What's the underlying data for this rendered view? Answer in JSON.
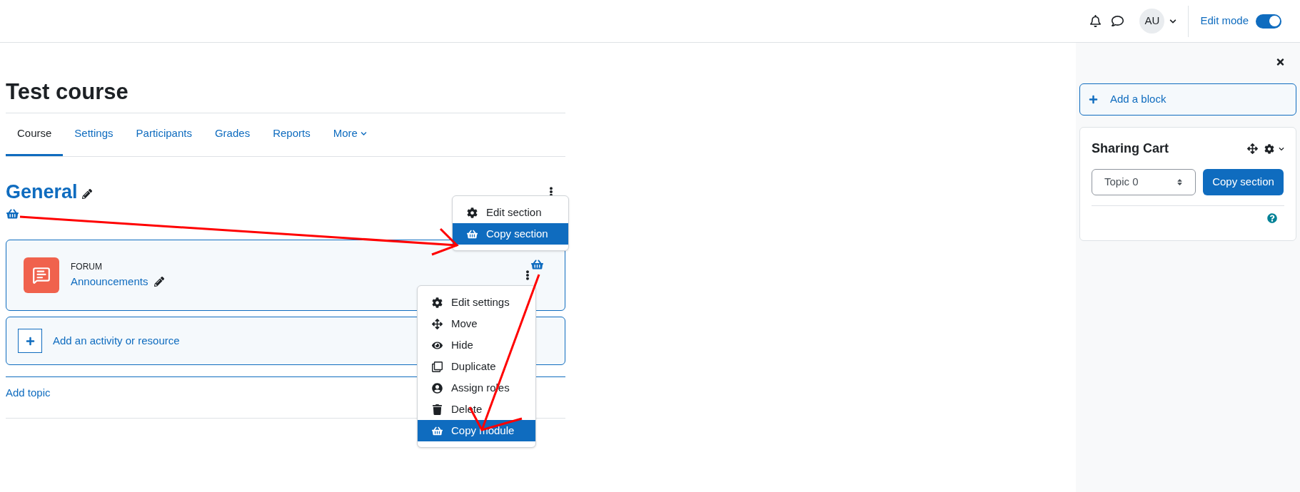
{
  "header": {
    "avatar": "AU",
    "edit_mode": {
      "label": "Edit mode",
      "on": true
    }
  },
  "course": {
    "title": "Test course",
    "tabs": [
      {
        "label": "Course",
        "selected": true
      },
      {
        "label": "Settings",
        "selected": false
      },
      {
        "label": "Participants",
        "selected": false
      },
      {
        "label": "Grades",
        "selected": false
      },
      {
        "label": "Reports",
        "selected": false
      },
      {
        "label": "More",
        "selected": false,
        "kind": "dropdown"
      }
    ]
  },
  "section": {
    "title": "General",
    "menu": [
      {
        "label": "Edit section",
        "selected": false
      },
      {
        "label": "Copy section",
        "selected": true
      }
    ]
  },
  "activity": {
    "type": "FORUM",
    "name": "Announcements",
    "menu": [
      {
        "label": "Edit settings",
        "selected": false
      },
      {
        "label": "Move",
        "selected": false
      },
      {
        "label": "Hide",
        "selected": false
      },
      {
        "label": "Duplicate",
        "selected": false
      },
      {
        "label": "Assign roles",
        "selected": false
      },
      {
        "label": "Delete",
        "selected": false
      },
      {
        "label": "Copy module",
        "selected": true
      }
    ]
  },
  "add_activity": "Add an activity or resource",
  "add_topic": "Add topic",
  "drawer": {
    "add_block": "Add a block",
    "block": {
      "title": "Sharing Cart",
      "select": {
        "value": "Topic 0"
      },
      "button": "Copy section"
    }
  }
}
